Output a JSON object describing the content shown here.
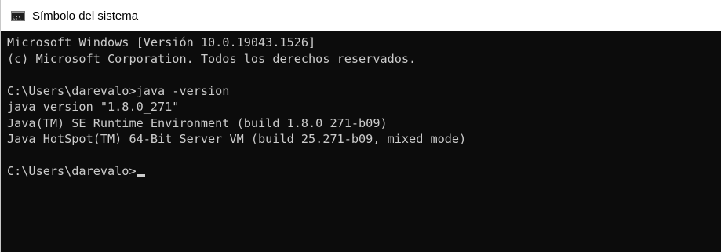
{
  "window": {
    "title": "Símbolo del sistema",
    "icon": "cmd-icon"
  },
  "console": {
    "lines": [
      "Microsoft Windows [Versión 10.0.19043.1526]",
      "(c) Microsoft Corporation. Todos los derechos reservados.",
      "",
      "C:\\Users\\darevalo>java -version",
      "java version \"1.8.0_271\"",
      "Java(TM) SE Runtime Environment (build 1.8.0_271-b09)",
      "Java HotSpot(TM) 64-Bit Server VM (build 25.271-b09, mixed mode)",
      ""
    ],
    "prompt": "C:\\Users\\darevalo>"
  },
  "colors": {
    "background": "#0c0c0c",
    "text": "#cccccc",
    "titlebar": "#ffffff"
  }
}
